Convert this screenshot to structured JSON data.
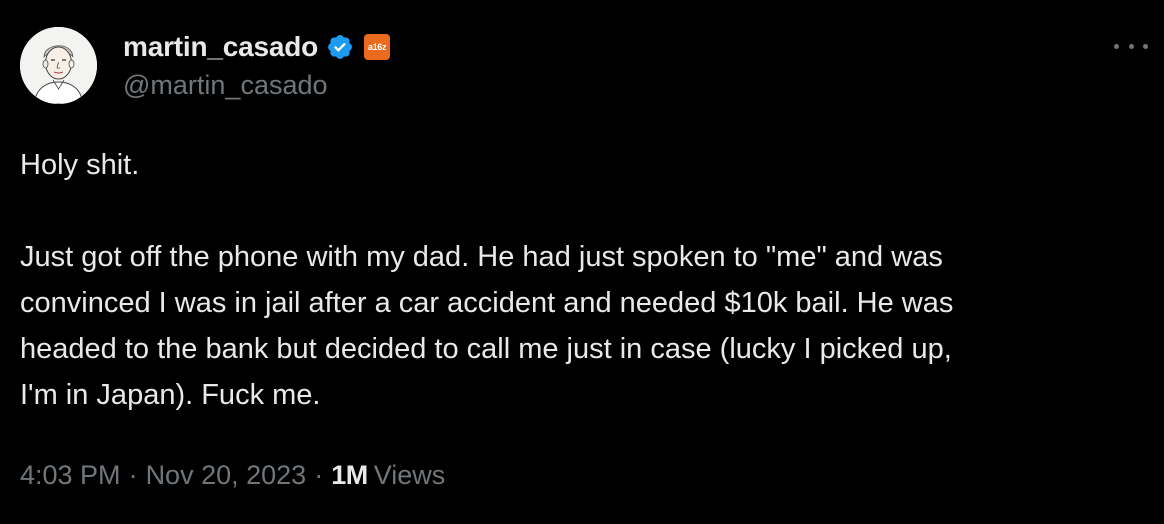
{
  "author": {
    "display_name": "martin_casado",
    "handle": "@martin_casado",
    "affiliate_badge": "a16z",
    "verified": true,
    "verified_color": "#1d9bf0",
    "affiliate_color": "#ea6a1e"
  },
  "tweet": {
    "lines": [
      "Holy shit.",
      "",
      "Just got off the phone with my dad. He had just spoken to \"me\" and was",
      "convinced I was in jail after a car accident and needed $10k bail. He was",
      "headed to the bank but decided to call me just in case (lucky I picked up,",
      "I'm in Japan). Fuck me."
    ]
  },
  "meta": {
    "time": "4:03 PM",
    "separator": "·",
    "date": "Nov 20, 2023",
    "views_count": "1M",
    "views_label": "Views"
  },
  "icons": {
    "more": "more-horizontal-icon",
    "verified": "verified-badge-icon"
  },
  "colors": {
    "background": "#000000",
    "primary_text": "#e7e9ea",
    "secondary_text": "#71767b"
  }
}
